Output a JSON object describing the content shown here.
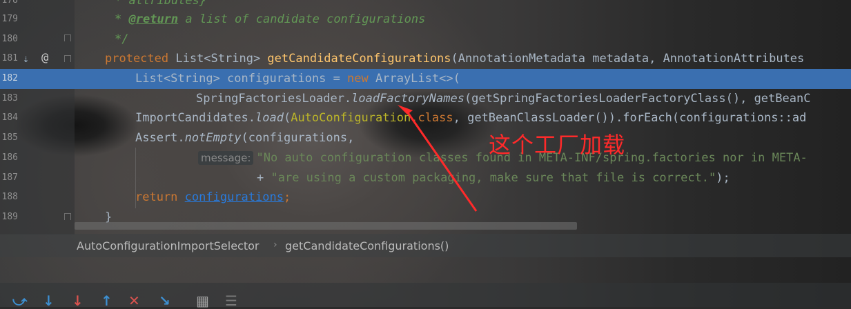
{
  "editor": {
    "lines": [
      {
        "num": "178",
        "text": ""
      },
      {
        "num": "179",
        "tag": "@return",
        "comment": " a list of candidate configurations"
      },
      {
        "num": "180",
        "comment": "*/"
      },
      {
        "num": "181",
        "kw": "protected",
        "type": " List<String> ",
        "method": "getCandidateConfigurations",
        "rest": "(AnnotationMetadata metadata, AnnotationAttributes"
      },
      {
        "num": "182",
        "a": "List<String> configurations = ",
        "kw": "new",
        "b": " ArrayList<>("
      },
      {
        "num": "183",
        "a": "SpringFactoriesLoader.",
        "it": "loadFactoryNames",
        "b": "(getSpringFactoriesLoaderFactoryClass(), getBeanC"
      },
      {
        "num": "184",
        "a": "ImportCandidates.",
        "it": "load",
        "b": "(",
        "ann": "AutoConfiguration",
        "kw": ".class",
        "c": ", getBeanClassLoader()).forEach(configurations::ad"
      },
      {
        "num": "185",
        "a": "Assert.",
        "it": "notEmpty",
        "b": "(configurations,"
      },
      {
        "num": "186",
        "hint": "message:",
        "str": "\"No auto configuration classes found in META-INF/spring.factories nor in META-"
      },
      {
        "num": "187",
        "a": "+ ",
        "str": "\"are using a custom packaging, make sure that file is correct.\"",
        "b": ");"
      },
      {
        "num": "188",
        "kw": "return",
        "link": "configurations",
        "semi": ";"
      },
      {
        "num": "189",
        "a": "}"
      }
    ],
    "top_partial_comment": "* attributes}",
    "star": "*"
  },
  "annotation": {
    "text": "这个工厂加载",
    "color": "#ff2a2a"
  },
  "breadcrumb": {
    "class_name": "AutoConfigurationImportSelector",
    "method_name": "getCandidateConfigurations()"
  },
  "gutter_icons": {
    "override": "override-icon",
    "annotation": "@"
  },
  "toolbar": {
    "icons": [
      "step-over-icon",
      "step-into-icon",
      "force-step-into-icon",
      "step-out-icon",
      "drop-frame-icon",
      "run-to-cursor-icon",
      "evaluate-expression-icon",
      "trace-icon"
    ]
  }
}
